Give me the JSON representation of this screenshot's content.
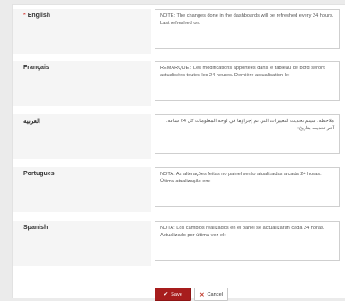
{
  "fields": [
    {
      "label": "English",
      "required": true,
      "value": "NOTE: The changes done in the dashboards will be refreshed every 24 hours. Last refreshed on:"
    },
    {
      "label": "Français",
      "required": false,
      "value": "REMARQUE : Les modifications apportées dans le tableau de bord seront actualisées toutes les 24 heures. Dernière actualisation le:"
    },
    {
      "label": "العربية",
      "required": false,
      "value": "ملاحظة: سيتم تحديث التغييرات التي تم إجراؤها في لوحة المعلومات كل 24 ساعة. آخر تحديث بتاريخ:"
    },
    {
      "label": "Portugues",
      "required": false,
      "value": "NOTA: As alterações feitas no painel serão atualizadas a cada 24 horas. Última atualização em:"
    },
    {
      "label": "Spanish",
      "required": false,
      "value": "NOTA: Los cambios realizados en el panel se actualizarán cada 24 horas. Actualizado por última vez el:"
    }
  ],
  "required_marker": "*",
  "buttons": {
    "save_label": "Save",
    "cancel_label": "Cancel",
    "save_icon": "check-icon",
    "cancel_icon": "close-icon"
  },
  "colors": {
    "save_bg": "#a71d1d",
    "required": "#d9534f"
  }
}
